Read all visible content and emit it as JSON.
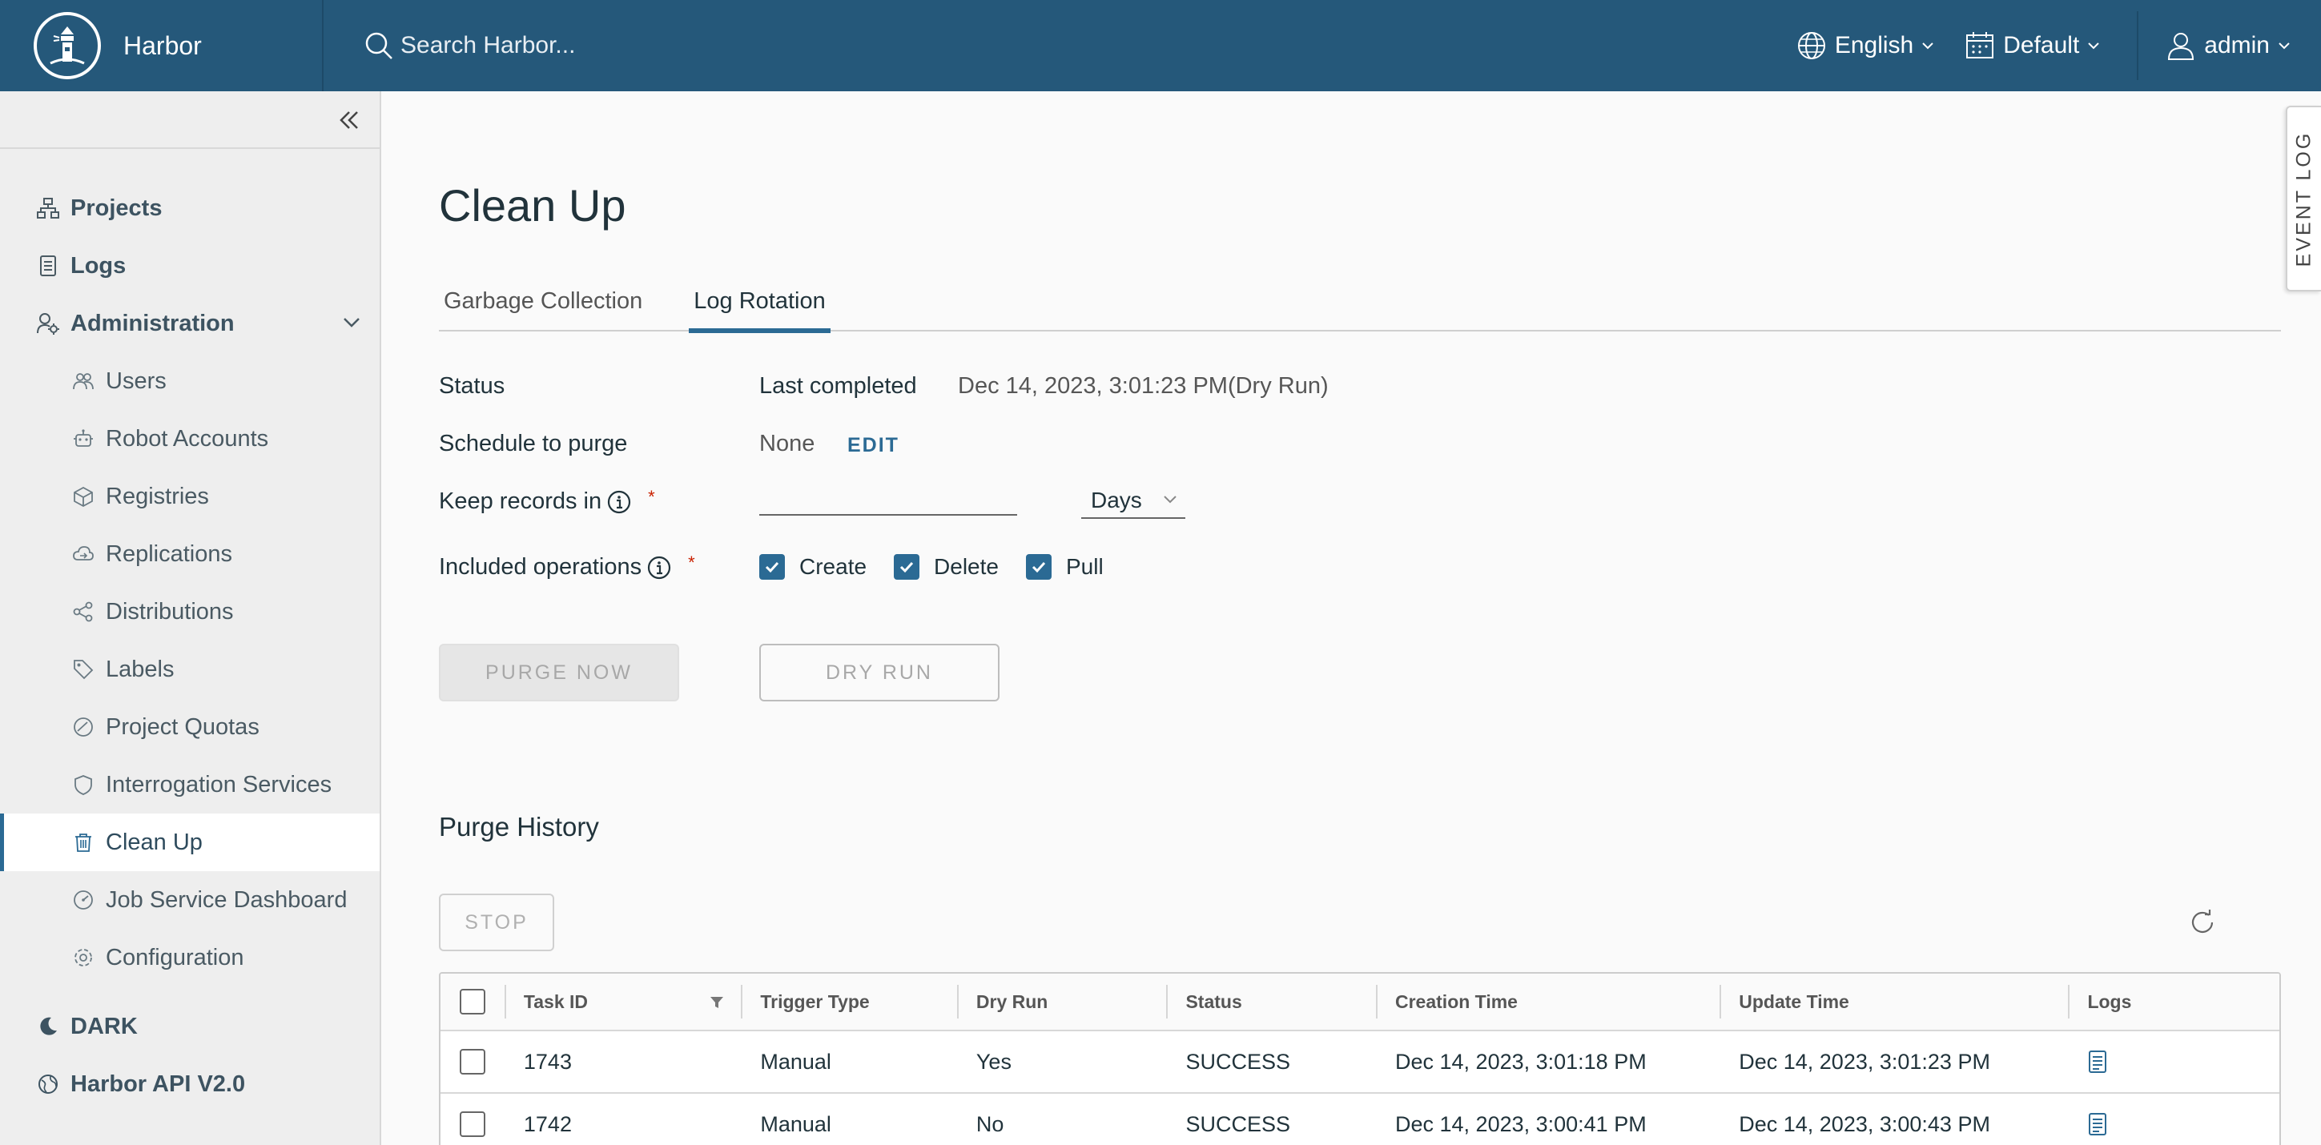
{
  "header": {
    "brand": "Harbor",
    "search_placeholder": "Search Harbor...",
    "language": "English",
    "theme_scope": "Default",
    "user": "admin"
  },
  "sidebar": {
    "projects": "Projects",
    "logs": "Logs",
    "administration": "Administration",
    "items": [
      "Users",
      "Robot Accounts",
      "Registries",
      "Replications",
      "Distributions",
      "Labels",
      "Project Quotas",
      "Interrogation Services",
      "Clean Up",
      "Job Service Dashboard",
      "Configuration"
    ],
    "active_item": "Clean Up",
    "dark": "DARK",
    "api": "Harbor API V2.0"
  },
  "page": {
    "title": "Clean Up",
    "tabs": [
      "Garbage Collection",
      "Log Rotation"
    ],
    "active_tab": "Log Rotation"
  },
  "form": {
    "status_label": "Status",
    "status_prefix": "Last completed",
    "status_value": "Dec 14, 2023, 3:01:23 PM(Dry Run)",
    "schedule_label": "Schedule to purge",
    "schedule_value": "None",
    "edit_label": "EDIT",
    "keep_label": "Keep records in",
    "keep_value": "",
    "keep_unit": "Days",
    "ops_label": "Included operations",
    "ops": [
      {
        "label": "Create",
        "checked": true
      },
      {
        "label": "Delete",
        "checked": true
      },
      {
        "label": "Pull",
        "checked": true
      }
    ],
    "required_mark": "*",
    "purge_now": "PURGE NOW",
    "dry_run": "DRY RUN"
  },
  "history": {
    "title": "Purge History",
    "stop": "STOP",
    "columns": [
      "Task ID",
      "Trigger Type",
      "Dry Run",
      "Status",
      "Creation Time",
      "Update Time",
      "Logs"
    ],
    "rows": [
      {
        "task_id": "1743",
        "trigger": "Manual",
        "dry_run": "Yes",
        "status": "SUCCESS",
        "created": "Dec 14, 2023, 3:01:18 PM",
        "updated": "Dec 14, 2023, 3:01:23 PM"
      },
      {
        "task_id": "1742",
        "trigger": "Manual",
        "dry_run": "No",
        "status": "SUCCESS",
        "created": "Dec 14, 2023, 3:00:41 PM",
        "updated": "Dec 14, 2023, 3:00:43 PM"
      }
    ]
  },
  "event_log": "EVENT LOG",
  "icons": {
    "brand": "harbor-lighthouse-icon",
    "search": "search-icon",
    "language": "globe-icon",
    "calendar": "calendar-icon",
    "user": "user-icon",
    "collapse": "double-chevron-left-icon",
    "info": "info-icon",
    "refresh": "refresh-icon",
    "filter": "filter-icon",
    "log": "log-file-icon"
  },
  "colors": {
    "header_bg": "#25587a",
    "accent": "#2b6a94",
    "required": "#c92100"
  }
}
